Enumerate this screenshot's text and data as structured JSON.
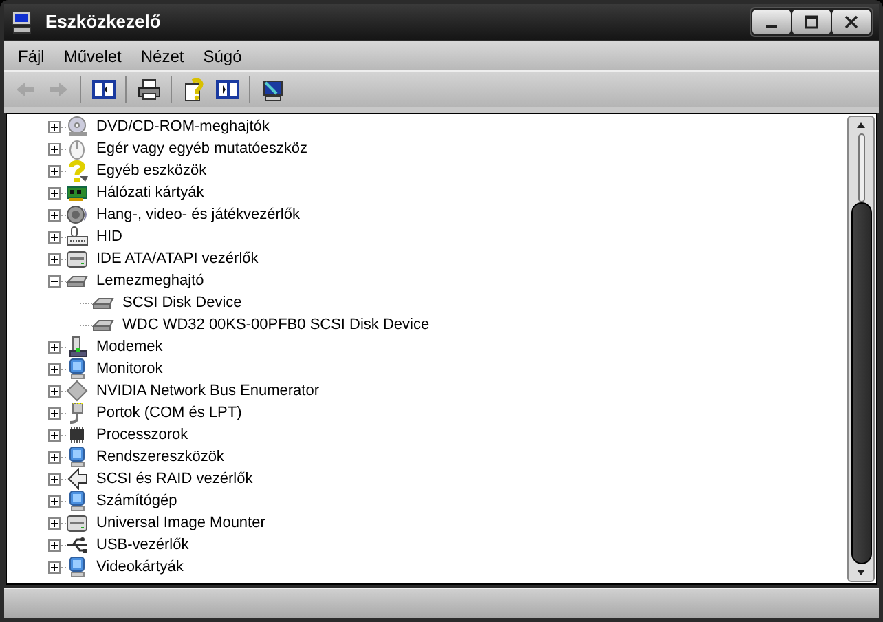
{
  "window": {
    "title": "Eszközkezelő"
  },
  "menu": [
    "Fájl",
    "Művelet",
    "Nézet",
    "Súgó"
  ],
  "toolbar": [
    {
      "disabled": true
    },
    {
      "disabled": true
    },
    {
      "disabled": false
    },
    {
      "disabled": false
    },
    {
      "disabled": false
    },
    {
      "disabled": false
    },
    {
      "disabled": false
    }
  ],
  "tree": [
    {
      "label": "DVD/CD-ROM-meghajtók",
      "expanded": false
    },
    {
      "label": "Egér vagy egyéb mutatóeszköz",
      "expanded": false
    },
    {
      "label": "Egyéb eszközök",
      "expanded": false
    },
    {
      "label": "Hálózati kártyák",
      "expanded": false
    },
    {
      "label": "Hang-, video- és játékvezérlők",
      "expanded": false
    },
    {
      "label": "HID",
      "expanded": false
    },
    {
      "label": "IDE ATA/ATAPI vezérlők",
      "expanded": false
    },
    {
      "label": "Lemezmeghajtó",
      "expanded": true,
      "children": [
        {
          "label": "SCSI Disk Device"
        },
        {
          "label": "WDC WD32 00KS-00PFB0 SCSI Disk Device"
        }
      ]
    },
    {
      "label": "Modemek",
      "expanded": false
    },
    {
      "label": "Monitorok",
      "expanded": false
    },
    {
      "label": "NVIDIA Network Bus Enumerator",
      "expanded": false
    },
    {
      "label": "Portok (COM és LPT)",
      "expanded": false
    },
    {
      "label": "Processzorok",
      "expanded": false
    },
    {
      "label": "Rendszereszközök",
      "expanded": false
    },
    {
      "label": "SCSI és RAID vezérlők",
      "expanded": false
    },
    {
      "label": "Számítógép",
      "expanded": false
    },
    {
      "label": "Universal Image Mounter",
      "expanded": false
    },
    {
      "label": "USB-vezérlők",
      "expanded": false
    },
    {
      "label": "Videokártyák",
      "expanded": false
    }
  ]
}
